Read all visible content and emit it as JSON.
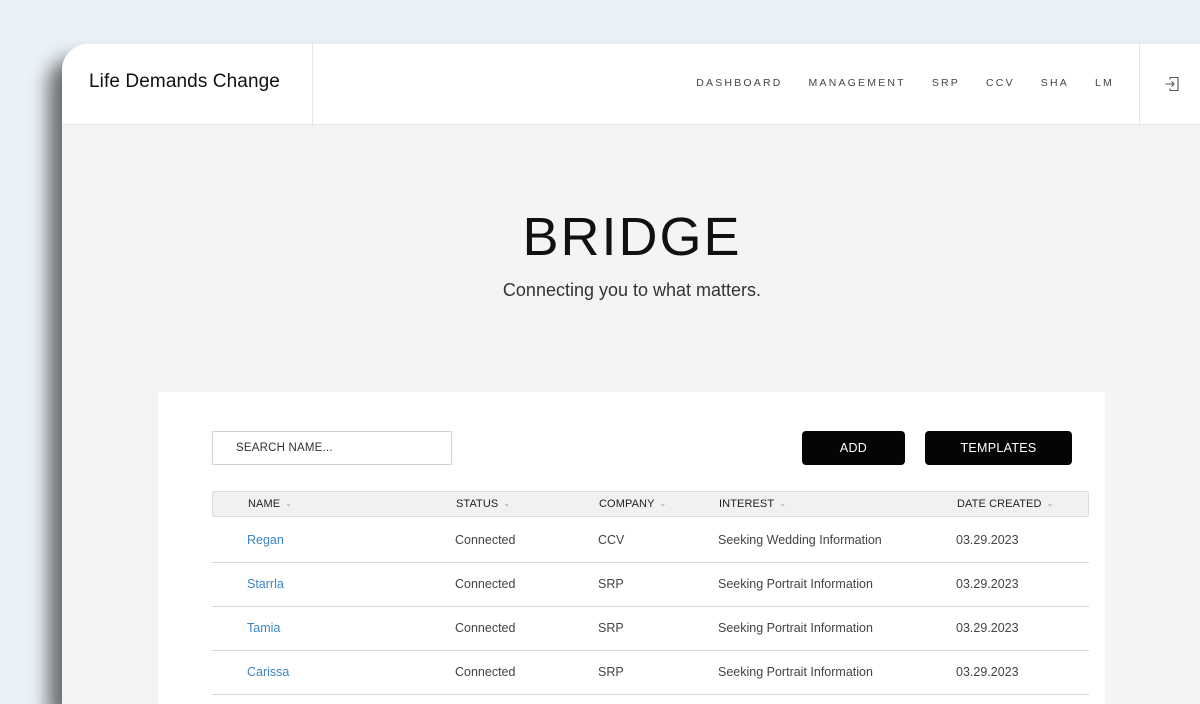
{
  "header": {
    "brand": "Life Demands Change",
    "nav": [
      "DASHBOARD",
      "MANAGEMENT",
      "SRP",
      "CCV",
      "SHA",
      "LM"
    ],
    "logout_icon": "logout-icon"
  },
  "hero": {
    "title": "BRIDGE",
    "subtitle": "Connecting you to what matters."
  },
  "toolbar": {
    "search_placeholder": "SEARCH NAME...",
    "add_label": "ADD",
    "templates_label": "TEMPLATES"
  },
  "table": {
    "columns": [
      "NAME",
      "STATUS",
      "COMPANY",
      "INTEREST",
      "DATE CREATED"
    ],
    "rows": [
      {
        "name": "Regan",
        "status": "Connected",
        "company": "CCV",
        "interest": "Seeking Wedding Information",
        "date": "03.29.2023"
      },
      {
        "name": "Starrla",
        "status": "Connected",
        "company": "SRP",
        "interest": "Seeking Portrait Information",
        "date": "03.29.2023"
      },
      {
        "name": "Tamia",
        "status": "Connected",
        "company": "SRP",
        "interest": "Seeking Portrait Information",
        "date": "03.29.2023"
      },
      {
        "name": "Carissa",
        "status": "Connected",
        "company": "SRP",
        "interest": "Seeking Portrait Information",
        "date": "03.29.2023"
      }
    ]
  },
  "colors": {
    "link": "#3d85c6",
    "button": "#050505",
    "background": "#f4f4f4",
    "outer_background": "#eaf2f7"
  }
}
